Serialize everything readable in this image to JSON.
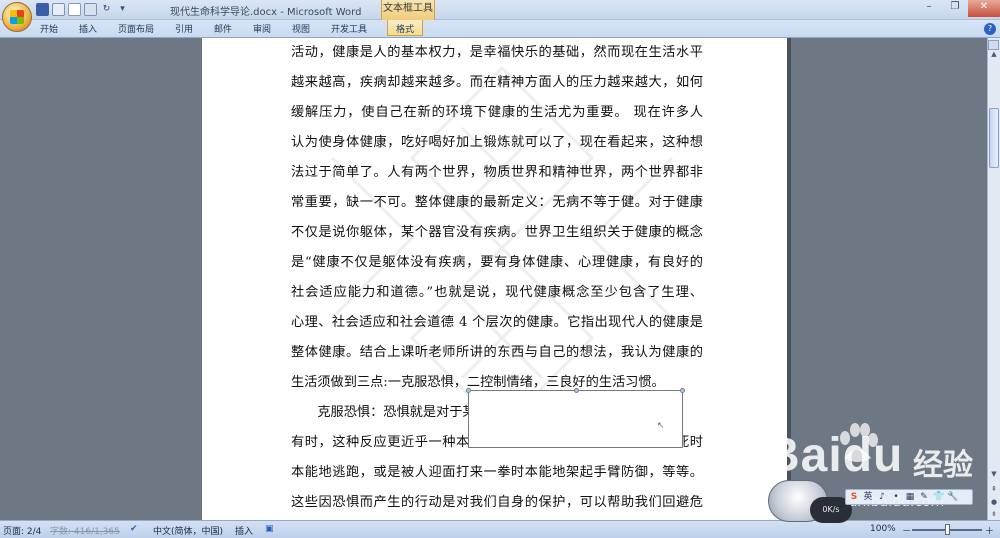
{
  "window": {
    "title": "现代生命科学导论.docx - Microsoft Word",
    "context_tab_title": "文本框工具",
    "controls": {
      "minimize": "–",
      "restore": "❐",
      "close": "✕"
    }
  },
  "ribbon": {
    "tabs": [
      "开始",
      "插入",
      "页面布局",
      "引用",
      "邮件",
      "审阅",
      "视图",
      "开发工具"
    ],
    "context_tab": "格式",
    "help": "?"
  },
  "document": {
    "lines": [
      "活动，健康是人的基本权力，是幸福快乐的基础，然而现在生活水平",
      "越来越高，疾病却越来越多。而在精神方面人的压力越来越大，如何",
      "缓解压力，使自己在新的环境下健康的生活尤为重要。 现在许多人",
      "认为使身体健康，吃好喝好加上锻炼就可以了，现在看起来，这种想",
      "法过于简单了。人有两个世界，物质世界和精神世界，两个世界都非",
      "常重要，缺一不可。整体健康的最新定义：无病不等于健。对于健康",
      "不仅是说你躯体，某个器官没有疾病。世界卫生组织关于健康的概念",
      "是“健康不仅是躯体没有疾病，要有身体健康、心理健康，有良好的",
      "社会适应能力和道德。”也就是说，现代健康概念至少包含了生理、",
      "心理、社会适应和社会道德 4 个层次的健康。它指出现代人的健康是",
      "整体健康。结合上课听老师所讲的东西与自己的想法，我认为健康的",
      "生活须做到三点:一克服恐惧，二控制情绪，三良好的生活习惯。",
      "　　克服恐惧：恐惧就是对于某种危险情况所产生的一种正常反应。",
      "有时，这种反应更近乎一种本能，例如遇到猛兽时我们会吓得要死时",
      "本能地逃跑，或是被人迎面打来一拳时本能地架起手臂防御，等等。",
      "这些因恐惧而产生的行动是对我们自身的保护，可以帮助我们回避危"
    ]
  },
  "statusbar": {
    "page": "页面: 2/4",
    "words": "字数: 416/1,365",
    "language": "中文(简体，中国)",
    "mode": "插入",
    "zoom": "100%",
    "zoom_minus": "－",
    "zoom_plus": "＋"
  },
  "overlay": {
    "baidu_brand": "Baidu",
    "baidu_jingyan": "经验",
    "baidu_url": "jingyan.baidu.com",
    "speed_text": "0K/s",
    "float_toolbar": [
      "S",
      "英",
      "♪",
      "•",
      "▦",
      "✎",
      "👕",
      "🔧"
    ]
  },
  "colors": {
    "workspace_bg": "#6e7784",
    "ribbon_bg": "#c9daf0",
    "context_tab": "#f5d98e"
  }
}
